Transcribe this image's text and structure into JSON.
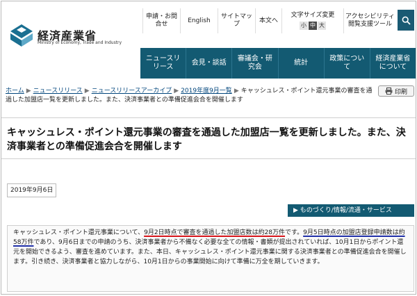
{
  "header": {
    "logo_name": "経済産業省",
    "logo_sub": "Ministry of Economy, Trade and Industry",
    "utility": {
      "inquiry": "申請・お問合せ",
      "english": "English",
      "sitemap": "サイトマップ",
      "text_only": "本文へ",
      "font_size_label": "文字サイズ変更",
      "font_small": "小",
      "font_medium": "中",
      "font_large": "大",
      "accessibility": "アクセシビリティ閲覧支援ツール"
    }
  },
  "nav": [
    "ニュースリリース",
    "会見・談話",
    "審議会・研究会",
    "統計",
    "政策について",
    "経済産業省について"
  ],
  "breadcrumb": {
    "items": [
      "ホーム",
      "ニュースリリース",
      "ニュースリリースアーカイブ",
      "2019年度9月一覧"
    ],
    "current": "キャッシュレス・ポイント還元事業の審査を通過した加盟店一覧を更新しました。また、決済事業者との準備促進会合を開催します"
  },
  "print_label": "印刷",
  "title": "キャッシュレス・ポイント還元事業の審査を通過した加盟店一覧を更新しました。また、決済事業者との準備促進会合を開催します",
  "date": "2019年9月6日",
  "category": "ものづくり/情報/流通・サービス",
  "body": {
    "p1": "キャッシュレス・ポイント還元事業について、",
    "red": "9月2日時点で審査を通過した加盟店数は約28万件",
    "p2": "です。",
    "blue": "9月5日時点の加盟店登録申請数は約58万件",
    "p3": "であり、9月6日までの申請のうち、決済事業者から不備なく必要な全ての情報・書類が提出されていれば、10月1日からポイント還元を開始できるよう、審査を進めています。また、本日、キャッシュレス・ポイント還元事業に関する決済事業者との準備促進会合を開催します。引き続き、決済事業者と協力しながら、10月1日からの事業開始に向けて準備に万全を期していきます。"
  },
  "colors": {
    "nav_bg": "#135a72",
    "link": "#00457c",
    "underline_red": "#d7141a",
    "underline_blue": "#1f2fa8"
  }
}
